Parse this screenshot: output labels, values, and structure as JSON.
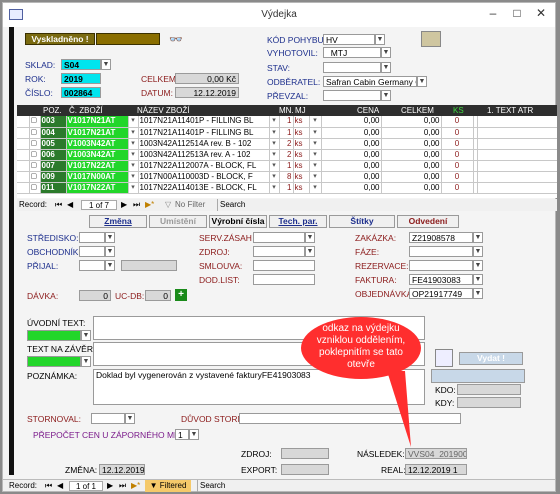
{
  "window": {
    "title": "Výdejka",
    "min": "–",
    "max": "□",
    "close": "✕"
  },
  "status_button": "Vyskladněno !",
  "labels": {
    "sklad": "SKLAD:",
    "rok": "ROK:",
    "cislo": "ČÍSLO:",
    "celkem": "CELKEM",
    "datum": "DATUM:",
    "kod_pohybu": "KÓD POHYBU:",
    "vyhotovil": "VYHOTOVIL:",
    "stav": "STAV:",
    "odberatel": "ODBĚRATEL:",
    "prevzal": "PŘEVZAL:"
  },
  "header_values": {
    "sklad": "S04",
    "rok": "2019",
    "cislo": "002864",
    "celkem": "0,00 Kč",
    "datum": "12.12.2019",
    "kod_pohybu": "HV",
    "vyhotovil": "_MTJ",
    "stav": "",
    "odberatel": "Safran Cabin Germany GmbH",
    "prevzal": ""
  },
  "grid": {
    "columns": [
      "POZ.",
      "Č. ZBOŽÍ",
      "NÁZEV ZBOŽÍ",
      "MN.",
      "MJ",
      "CENA",
      "CELKEM",
      "KS",
      "1. TEXT ATR"
    ],
    "rows": [
      {
        "poz": "003",
        "cislo": "V1017N21AT",
        "nazev": "1017N21A11401P - FILLING BL",
        "mn": "1",
        "mj": "ks",
        "cena": "0,00",
        "celkem": "0,00",
        "ks": "0"
      },
      {
        "poz": "004",
        "cislo": "V1017N21AT",
        "nazev": "1017N21A11401P - FILLING BL",
        "mn": "1",
        "mj": "ks",
        "cena": "0,00",
        "celkem": "0,00",
        "ks": "0"
      },
      {
        "poz": "005",
        "cislo": "V1003N42AT",
        "nazev": "1003N42A112514A rev. B - 102",
        "mn": "2",
        "mj": "ks",
        "cena": "0,00",
        "celkem": "0,00",
        "ks": "0"
      },
      {
        "poz": "006",
        "cislo": "V1003N42AT",
        "nazev": "1003N42A112513A rev. A - 102",
        "mn": "2",
        "mj": "ks",
        "cena": "0,00",
        "celkem": "0,00",
        "ks": "0"
      },
      {
        "poz": "007",
        "cislo": "V1017N22AT",
        "nazev": "1017N22A112007A - BLOCK, FL",
        "mn": "1",
        "mj": "ks",
        "cena": "0,00",
        "celkem": "0,00",
        "ks": "0"
      },
      {
        "poz": "009",
        "cislo": "V1017N00AT",
        "nazev": "1017N00A110003D - BLOCK, F",
        "mn": "8",
        "mj": "ks",
        "cena": "0,00",
        "celkem": "0,00",
        "ks": "0"
      },
      {
        "poz": "011",
        "cislo": "V1017N22AT",
        "nazev": "1017N22A114013E - BLOCK, FL",
        "mn": "1",
        "mj": "ks",
        "cena": "0,00",
        "celkem": "0,00",
        "ks": "0"
      }
    ],
    "record_label": "Record:",
    "record_pos": "1 of 7",
    "nofilter": "No Filter",
    "search": "Search"
  },
  "tabs": [
    "Změna",
    "Umístění",
    "Výrobní čísla",
    "Tech. par.",
    "Štítky",
    "Odvedení"
  ],
  "form_labels": {
    "stredisko": "STŘEDISKO:",
    "obchodnik": "OBCHODNÍK:",
    "prijal": "PŘIJAL:",
    "davka": "DÁVKA:",
    "ucdb": "UC-DB:",
    "serv_zasah": "SERV.ZÁSAH",
    "zdroj": "ZDROJ:",
    "smlouva": "SMLOUVA:",
    "dod_list": "DOD.LIST:",
    "zakazka": "ZAKÁZKA:",
    "faze": "FÁZE:",
    "rezervace": "REZERVACE:",
    "faktura": "FAKTURA:",
    "objednavka": "OBJEDNÁVKA:",
    "uvodni_text": "ÚVODNÍ TEXT:",
    "text_na_zaver": "TEXT NA ZÁVĚR:",
    "poznamka": "POZNÁMKA:",
    "stornoval": "STORNOVAL:",
    "duvod_storna": "DŮVOD STORNA:",
    "prepocet": "PŘEPOČET CEN U ZÁPORNÉHO MNOŽ.:",
    "zdroj2": "ZDROJ:",
    "export": "EXPORT:",
    "nasledek": "NÁSLEDEK:",
    "zmena": "ZMĚNA:",
    "real": "REAL:",
    "kdo": "KDO:",
    "kdy": "KDY:",
    "vydat": "Vydat !"
  },
  "form_values": {
    "davka": "0",
    "ucdb": "0",
    "zakazka": "Z21908578",
    "faktura": "FE41903083",
    "objednavka": "OP21917749",
    "poznamka": "Doklad byl vygenerován z vystavené fakturyFE41903083",
    "prepocet": "1",
    "nasledek": "VVS04_201900",
    "zmena": "12.12.2019",
    "real": "12.12.2019 1"
  },
  "callout": "odkaz na výdejku vzniklou oddělením, poklepnitím se tato otevře",
  "bottom_nav": {
    "record_label": "Record:",
    "record_pos": "1 of 1",
    "filtered": "Filtered",
    "search": "Search"
  },
  "colors": {
    "cyan": "#00e5ee",
    "green": "#22d62a",
    "callout": "#ff2e2e",
    "header": "#2e2e2e"
  }
}
